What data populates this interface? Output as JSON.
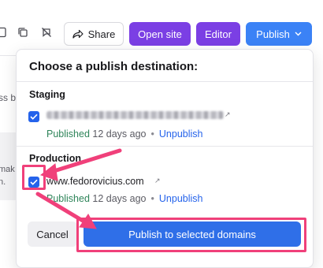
{
  "toolbar": {
    "share_label": "Share",
    "open_site_label": "Open site",
    "editor_label": "Editor",
    "publish_label": "Publish",
    "icons": [
      "page-icon",
      "copy-icon",
      "no-comment-icon",
      "share-arrow-icon",
      "chevron-down-icon"
    ]
  },
  "background": {
    "text_1": "ss b",
    "text_2": "mak",
    "text_3": "n."
  },
  "dropdown": {
    "title": "Choose a publish destination:",
    "staging": {
      "title": "Staging",
      "checked": true,
      "status": "Published",
      "ago": "12 days ago",
      "unpublish": "Unpublish"
    },
    "production": {
      "title": "Production",
      "checked": true,
      "domain": "www.fedorovicius.com",
      "status": "Published",
      "ago": "12 days ago",
      "unpublish": "Unpublish"
    },
    "cancel_label": "Cancel",
    "submit_label": "Publish to selected domains"
  },
  "colors": {
    "purple": "#7b3fe4",
    "blue": "#3b82f6",
    "published_green": "#2f855a",
    "annotation_pink": "#f0407a"
  }
}
